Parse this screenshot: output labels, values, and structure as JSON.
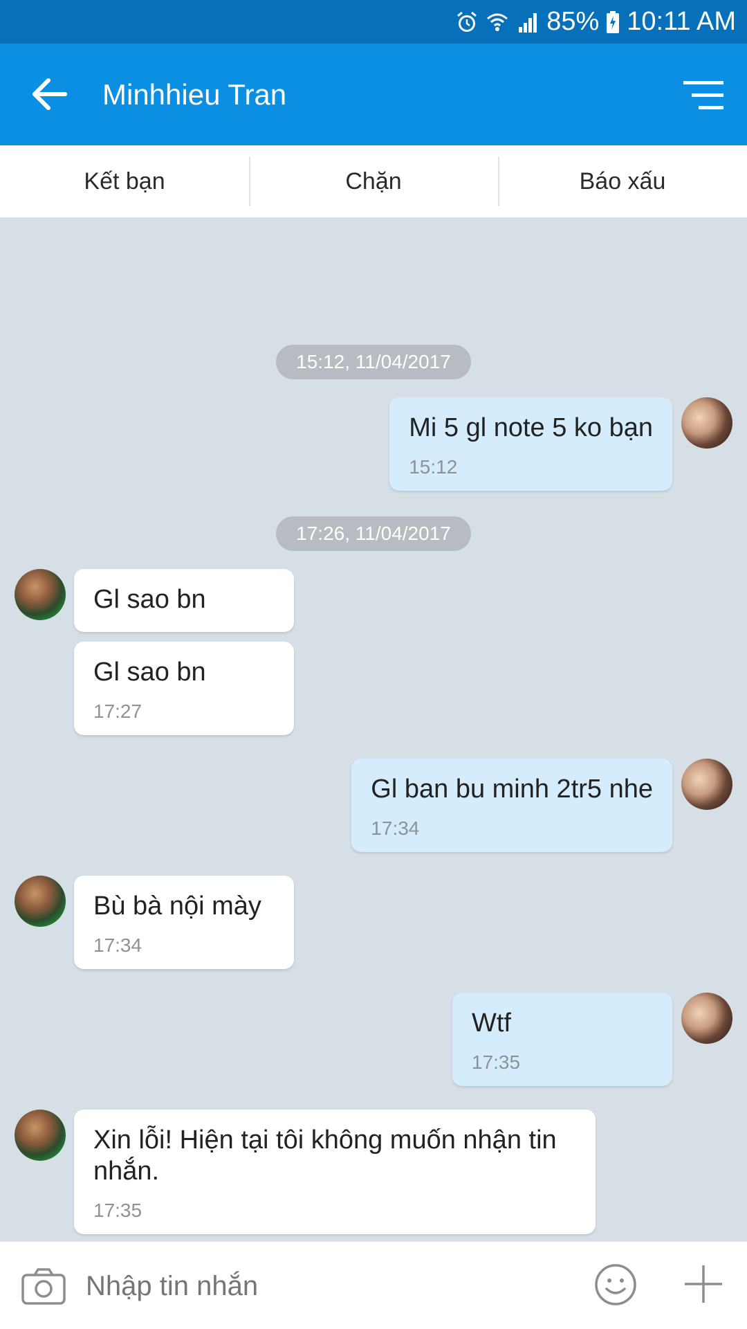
{
  "status": {
    "battery": "85%",
    "time": "10:11 AM"
  },
  "header": {
    "title": "Minhhieu Tran"
  },
  "actions": [
    {
      "label": "Kết bạn"
    },
    {
      "label": "Chặn"
    },
    {
      "label": "Báo xấu"
    }
  ],
  "chat": {
    "dates": [
      "15:12, 11/04/2017",
      "17:26, 11/04/2017"
    ],
    "messages": [
      {
        "dir": "out",
        "text": "Mi 5 gl note 5 ko bạn",
        "time": "15:12"
      },
      {
        "dir": "in",
        "text": "Gl sao bn",
        "time": ""
      },
      {
        "dir": "in",
        "text": "Gl sao bn",
        "time": "17:27"
      },
      {
        "dir": "out",
        "text": "Gl ban bu minh 2tr5 nhe",
        "time": "17:34"
      },
      {
        "dir": "in",
        "text": "Bù bà nội mày",
        "time": "17:34"
      },
      {
        "dir": "out",
        "text": "Wtf",
        "time": "17:35"
      },
      {
        "dir": "in",
        "text": "Xin lỗi! Hiện tại tôi không muốn nhận tin nhắn.",
        "time": "17:35"
      }
    ]
  },
  "composer": {
    "placeholder": "Nhập tin nhắn"
  },
  "colors": {
    "statusbar": "#0670bb",
    "appbar": "#0a8fe3",
    "background": "#d6dfe5",
    "outgoing": "#d4ecfb",
    "incoming": "#ffffff"
  }
}
